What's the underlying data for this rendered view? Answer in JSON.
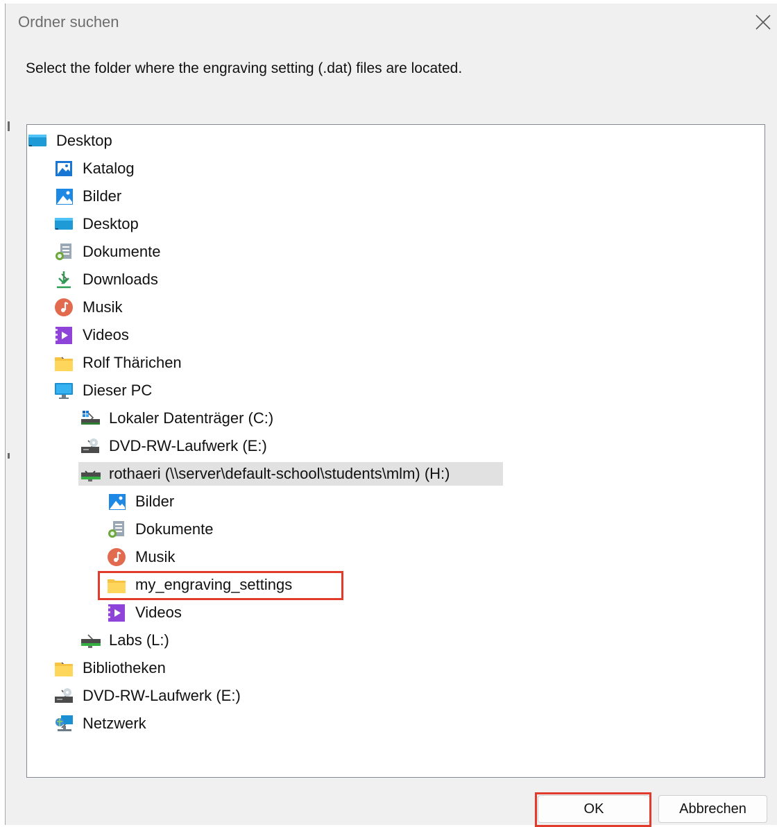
{
  "window": {
    "title": "Ordner suchen",
    "close_icon": "close-icon"
  },
  "instruction": "Select the folder where the engraving setting (.dat) files are located.",
  "tree": [
    {
      "label": "Desktop",
      "icon": "desktop-icon",
      "level": 0,
      "chevron": "none"
    },
    {
      "label": "Katalog",
      "icon": "gallery-icon",
      "level": 1,
      "chevron": "none"
    },
    {
      "label": "Bilder",
      "icon": "pictures-icon",
      "level": 1,
      "chevron": "right"
    },
    {
      "label": "Desktop",
      "icon": "desktop-icon",
      "level": 1,
      "chevron": "right"
    },
    {
      "label": "Dokumente",
      "icon": "documents-icon",
      "level": 1,
      "chevron": "right"
    },
    {
      "label": "Downloads",
      "icon": "downloads-icon",
      "level": 1,
      "chevron": "right"
    },
    {
      "label": "Musik",
      "icon": "music-icon",
      "level": 1,
      "chevron": "right"
    },
    {
      "label": "Videos",
      "icon": "videos-icon",
      "level": 1,
      "chevron": "right"
    },
    {
      "label": "Rolf Thärichen",
      "icon": "folder-icon",
      "level": 1,
      "chevron": "right"
    },
    {
      "label": "Dieser PC",
      "icon": "computer-icon",
      "level": 1,
      "chevron": "down"
    },
    {
      "label": "Lokaler Datenträger (C:)",
      "icon": "local-drive-icon",
      "level": 2,
      "chevron": "right"
    },
    {
      "label": "DVD-RW-Laufwerk (E:)",
      "icon": "dvd-drive-icon",
      "level": 2,
      "chevron": "right"
    },
    {
      "label": "rothaeri (\\\\server\\default-school\\students\\mlm) (H:)",
      "icon": "network-drive-icon",
      "level": 2,
      "chevron": "down",
      "selected": true
    },
    {
      "label": "Bilder",
      "icon": "pictures-icon",
      "level": 3,
      "chevron": "right"
    },
    {
      "label": "Dokumente",
      "icon": "documents-icon",
      "level": 3,
      "chevron": "right"
    },
    {
      "label": "Musik",
      "icon": "music-icon",
      "level": 3,
      "chevron": "none"
    },
    {
      "label": "my_engraving_settings",
      "icon": "folder-icon",
      "level": 3,
      "chevron": "none",
      "highlighted": true
    },
    {
      "label": "Videos",
      "icon": "videos-icon",
      "level": 3,
      "chevron": "right"
    },
    {
      "label": "Labs (L:)",
      "icon": "network-drive-icon",
      "level": 2,
      "chevron": "right"
    },
    {
      "label": "Bibliotheken",
      "icon": "folder-icon",
      "level": 1,
      "chevron": "right"
    },
    {
      "label": "DVD-RW-Laufwerk (E:)",
      "icon": "dvd-drive-icon",
      "level": 1,
      "chevron": "right"
    },
    {
      "label": "Netzwerk",
      "icon": "network-icon",
      "level": 1,
      "chevron": "right"
    }
  ],
  "buttons": {
    "ok": "OK",
    "cancel": "Abbrechen"
  },
  "colors": {
    "dialog_bg": "#f0f0f0",
    "selected_row": "#e1e1e1",
    "callout": "#e23a2b"
  }
}
